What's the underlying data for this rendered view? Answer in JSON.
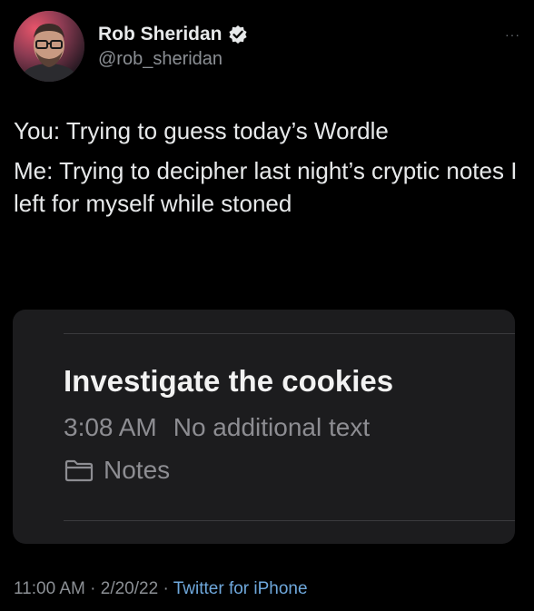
{
  "author": {
    "display_name": "Rob Sheridan",
    "handle": "@rob_sheridan",
    "verified_icon": "verified-badge-icon",
    "avatar_icon": "avatar"
  },
  "menu": {
    "more_icon": "more-options-icon",
    "more_glyph": "···"
  },
  "tweet": {
    "line1": "You: Trying to guess today’s Wordle",
    "line2": "Me: Trying to decipher last night’s cryptic notes I left for myself while stoned"
  },
  "note": {
    "title": "Investigate the cookies",
    "time": "3:08 AM",
    "preview": "No additional text",
    "folder_icon": "folder-icon",
    "folder": "Notes"
  },
  "footer": {
    "time": "11:00 AM",
    "sep1": " · ",
    "date": "2/20/22",
    "sep2": " · ",
    "source": "Twitter for iPhone"
  },
  "colors": {
    "background": "#000000",
    "card": "#1c1c1e",
    "link": "#6fa8dc",
    "muted": "#8b8f94"
  }
}
